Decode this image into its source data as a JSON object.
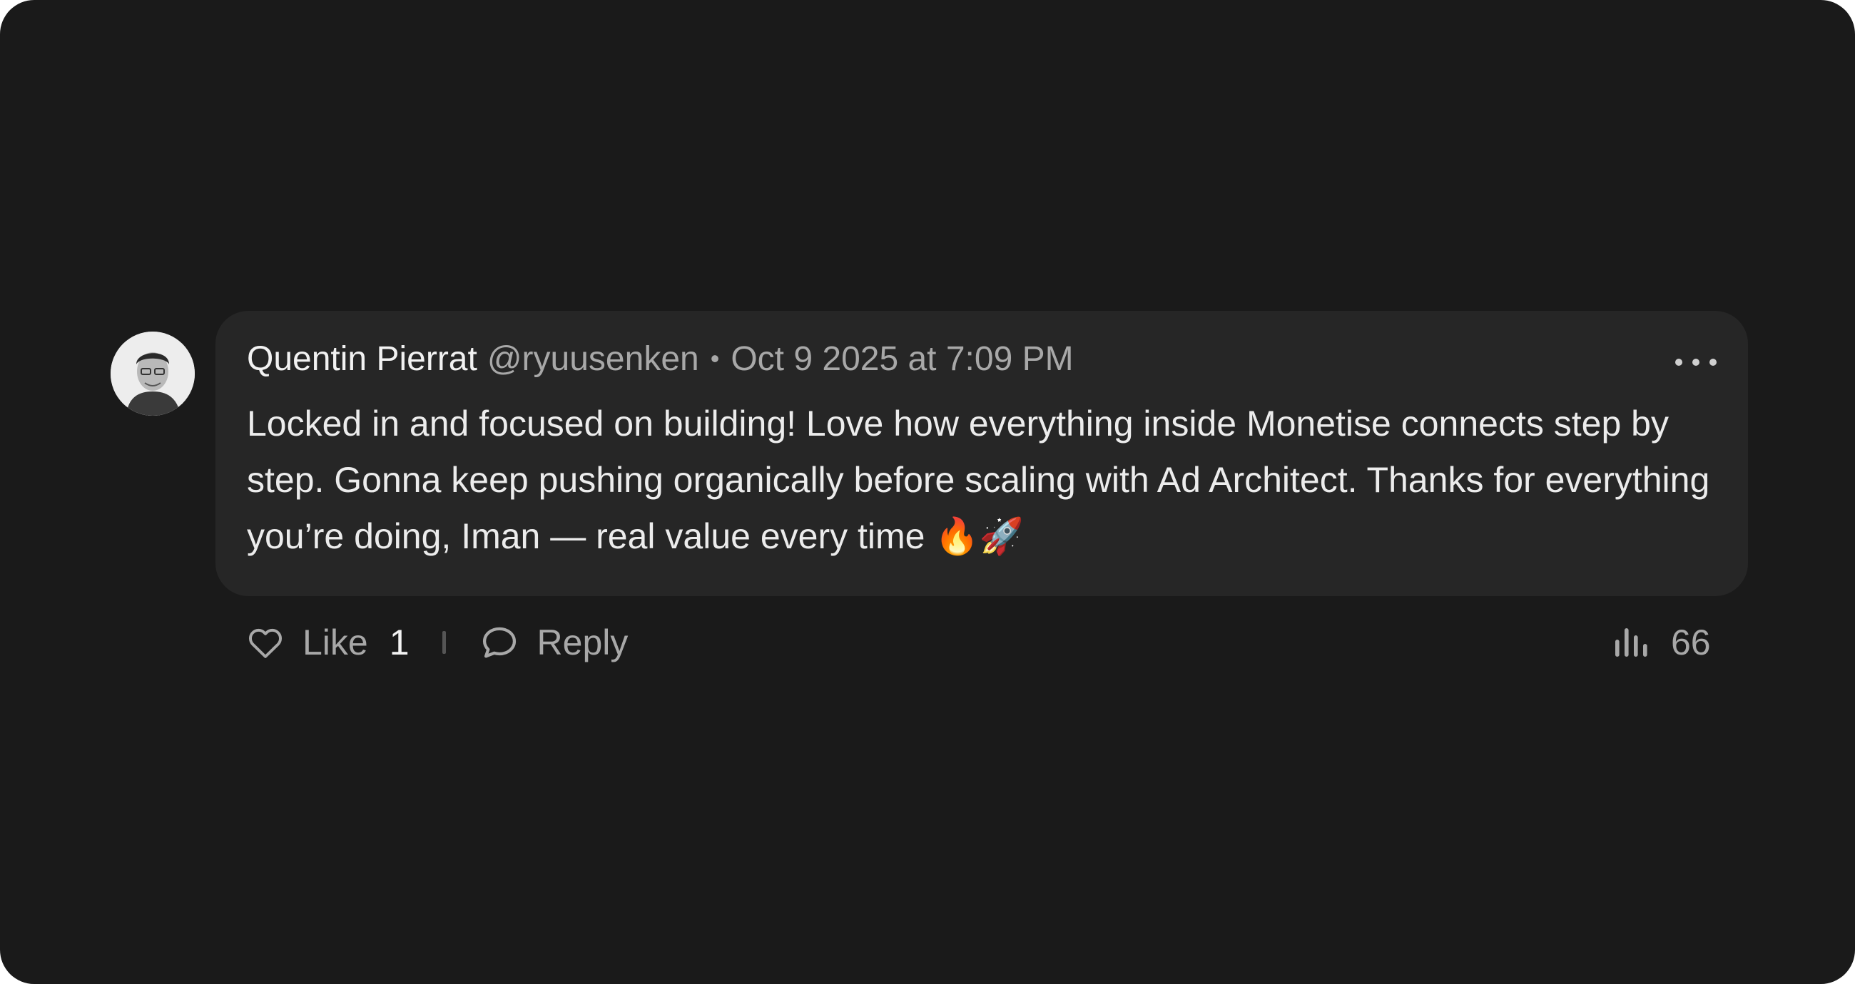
{
  "comment": {
    "author": "Quentin Pierrat",
    "handle": "@ryuusenken",
    "separator": "•",
    "timestamp": "Oct 9 2025 at 7:09 PM",
    "text": "Locked in and focused on building! Love how everything inside Monetise connects step by step. Gonna keep pushing organically before scaling with Ad Architect. Thanks for everything you’re doing, Iman — real value every time 🔥🚀"
  },
  "actions": {
    "like_label": "Like",
    "like_count": "1",
    "reply_label": "Reply",
    "views_count": "66"
  },
  "icons": {
    "like": "heart-outline-icon",
    "reply": "chat-bubble-icon",
    "views": "bar-chart-icon",
    "more": "more-horizontal-icon"
  },
  "colors": {
    "background": "#1a1a1a",
    "bubble": "#262626",
    "primary_text": "#ececec",
    "muted_text": "#a8a8a8"
  }
}
